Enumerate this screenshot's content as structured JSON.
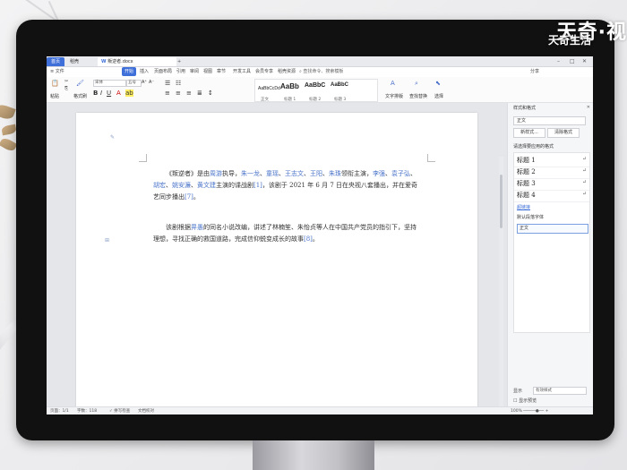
{
  "watermark": {
    "brand": "天奇·视",
    "sub": "天奇生活"
  },
  "app": {
    "tabs": [
      {
        "label": "首页"
      },
      {
        "label": "稻壳"
      },
      {
        "label": "叛逆者.docx"
      }
    ],
    "new_tab": "+",
    "window_controls": [
      "–",
      "□",
      "✕"
    ]
  },
  "menu": {
    "file": "≡ 文件",
    "items": [
      "开始",
      "插入",
      "页面布局",
      "引用",
      "审阅",
      "视图",
      "章节",
      "开发工具",
      "会员专享",
      "稻壳资源"
    ],
    "active_index": 0,
    "search": "查找命令、搜索模板",
    "share": "分享"
  },
  "ribbon": {
    "paste": "粘贴",
    "format_painter": "格式刷",
    "font": "宋体",
    "size": "五号",
    "styles": [
      {
        "preview": "AaBbCcDd",
        "label": "正文"
      },
      {
        "preview": "AaBb",
        "label": "标题 1"
      },
      {
        "preview": "AaBbC",
        "label": "标题 2"
      },
      {
        "preview": "AaBbC",
        "label": "标题 3"
      }
    ],
    "text_tools": "文字排版",
    "find_replace": "查找替换",
    "select": "选择"
  },
  "document": {
    "para1": {
      "a": "《叛逆者》是由",
      "b": "周游",
      "c": "执导，",
      "d": "朱一龙",
      "e": "、",
      "f": "童瑶",
      "g": "、",
      "h": "王志文",
      "i": "、",
      "j": "王阳",
      "k": "、",
      "l": "朱珠",
      "m": "领衔主演，",
      "n": "李强",
      "o": "、",
      "p": "袁子弘",
      "q": "、",
      "r": "胡宏",
      "s": "、",
      "t": "姚安濂",
      "u": "、",
      "v": "黄文建",
      "w": "主演的谍战剧",
      "x": "[1]",
      "y": "，该剧于 2021 年 6 月 7 日在央视八套播出，并在爱奇艺同步播出",
      "z": "[7]",
      "end": "。"
    },
    "para2": {
      "a": "该剧根据",
      "b": "畀愚",
      "c": "的同名小说改编，讲述了林楠笙、朱怡贞等人在中国共产党员的指引下，坚持理想，寻找正确的救国道路，完成信仰蜕变成长的故事",
      "d": "[8]",
      "end": "。"
    }
  },
  "pane": {
    "title": "样式和格式",
    "close": "✕",
    "current": "正文",
    "new_style": "新样式...",
    "clear": "清除格式",
    "prompt": "请选择要应用的格式",
    "styles": [
      {
        "name": "标题 1",
        "mark": "↵"
      },
      {
        "name": "标题 2",
        "mark": "↵"
      },
      {
        "name": "标题 3",
        "mark": "↵"
      },
      {
        "name": "标题 4",
        "mark": "↵"
      }
    ],
    "hyperlink": "超链接",
    "default_font": "默认段落字体",
    "body": "正文",
    "show_label": "显示",
    "show_value": "有效样式",
    "preview_label": "显示预览"
  },
  "status": {
    "page": "页面：1/1",
    "words": "字数：118",
    "spell": "✓ 拼写检查",
    "doc_check": "文档校对",
    "zoom": "100% ─────●── +"
  }
}
